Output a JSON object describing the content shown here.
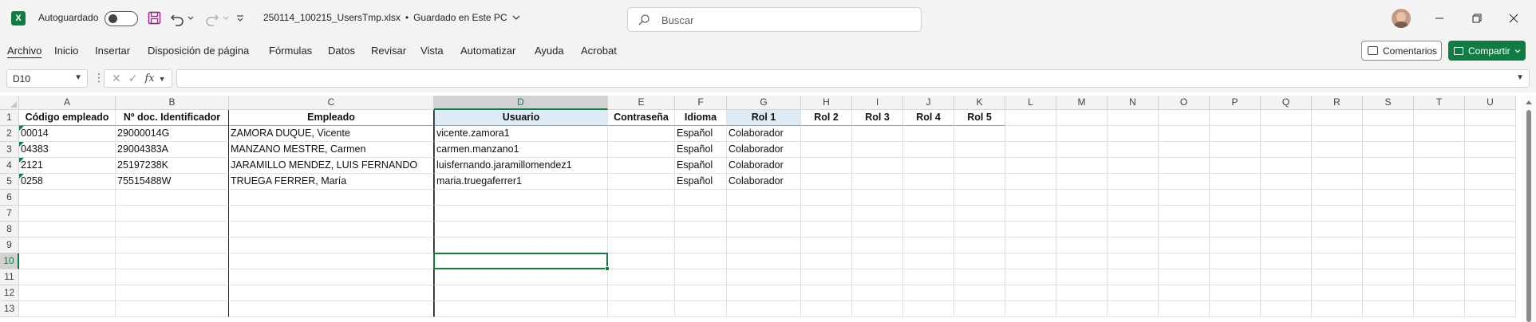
{
  "titlebar": {
    "autosave_label": "Autoguardado",
    "filename": "250114_100215_UsersTmp.xlsx",
    "save_status": "Guardado en Este PC",
    "search_placeholder": "Buscar"
  },
  "menu": [
    "Archivo",
    "Inicio",
    "Insertar",
    "Disposición de página",
    "Fórmulas",
    "Datos",
    "Revisar",
    "Vista",
    "Automatizar",
    "Ayuda",
    "Acrobat"
  ],
  "buttons": {
    "comments": "Comentarios",
    "share": "Compartir"
  },
  "formula_bar": {
    "name_box": "D10",
    "fx_label": "fx",
    "formula": ""
  },
  "sheet": {
    "columns": [
      "A",
      "B",
      "C",
      "D",
      "E",
      "F",
      "G",
      "H",
      "I",
      "J",
      "K",
      "L",
      "M",
      "N",
      "O",
      "P",
      "Q",
      "R",
      "S",
      "T",
      "U"
    ],
    "row_numbers": [
      "1",
      "2",
      "3",
      "4",
      "5",
      "6",
      "7",
      "8",
      "9",
      "10",
      "11",
      "12",
      "13"
    ],
    "headers": [
      "Código empleado",
      "Nº doc. Identificador",
      "Empleado",
      "Usuario",
      "Contraseña",
      "Idioma",
      "Rol 1",
      "Rol 2",
      "Rol 3",
      "Rol 4",
      "Rol 5"
    ],
    "rows": [
      [
        "00014",
        "29000014G",
        "ZAMORA DUQUE, Vicente",
        "vicente.zamora1",
        "",
        "Español",
        "Colaborador"
      ],
      [
        "04383",
        "29004383A",
        "MANZANO MESTRE, Carmen",
        "carmen.manzano1",
        "",
        "Español",
        "Colaborador"
      ],
      [
        "2121",
        "25197238K",
        "JARAMILLO MENDEZ, LUIS FERNANDO",
        "luisfernando.jaramillomendez1",
        "",
        "Español",
        "Colaborador"
      ],
      [
        "0258",
        "75515488W",
        "TRUEGA FERRER, María",
        "maria.truegaferrer1",
        "",
        "Español",
        "Colaborador"
      ]
    ],
    "active_cell": "D10",
    "accent_color": "#107c41",
    "header_fill_color": "#ddebf7"
  }
}
